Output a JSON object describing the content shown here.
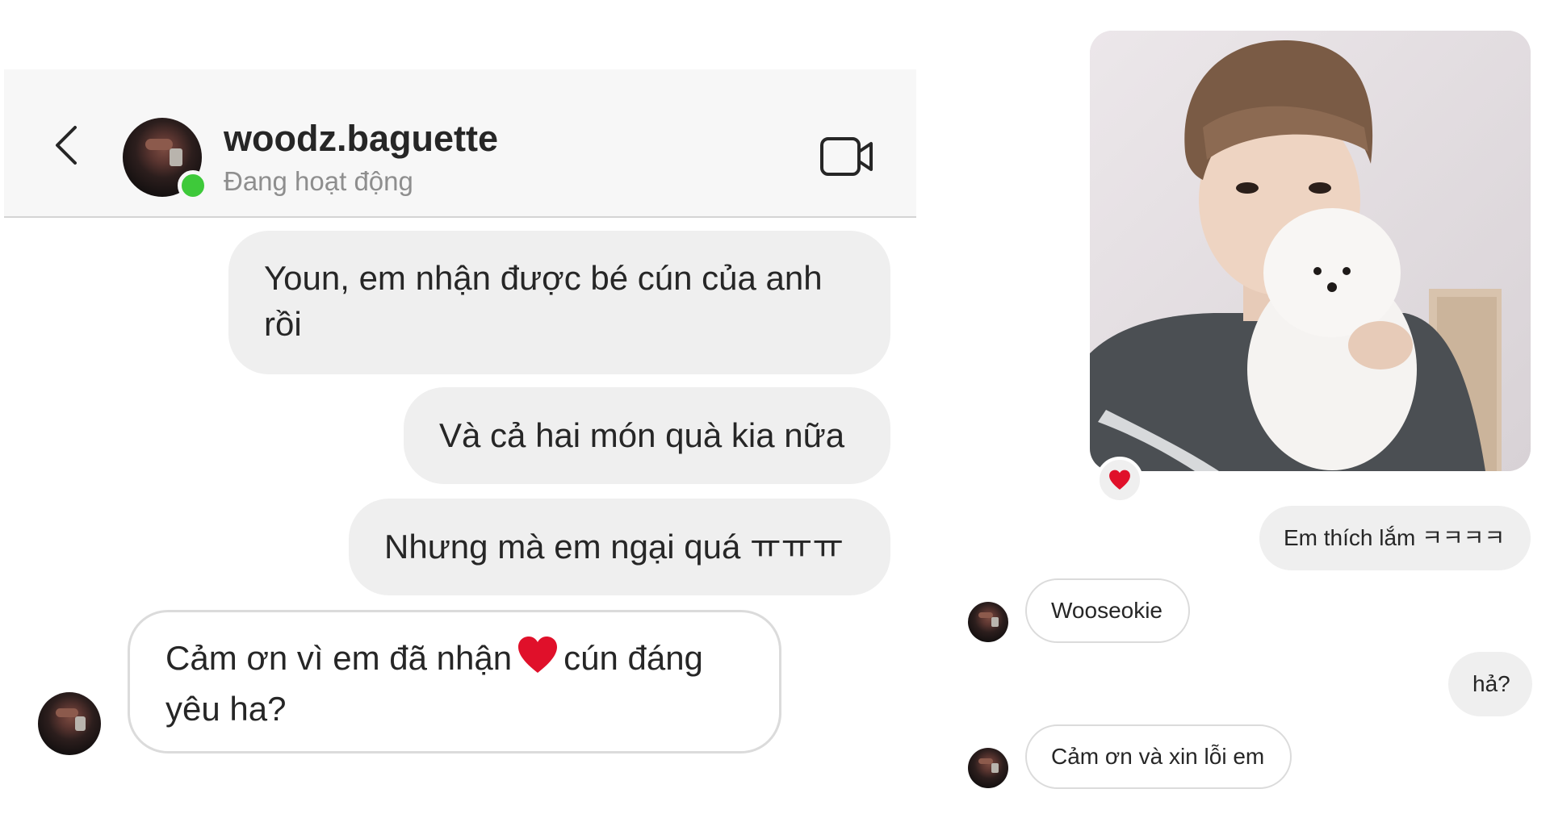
{
  "header": {
    "username": "woodz.baguette",
    "status": "Đang hoạt động"
  },
  "left_messages": {
    "m1": "Youn, em nhận được bé cún của anh rồi",
    "m2": "Và cả hai món quà kia nữa",
    "m3": "Nhưng mà em ngại quá ㅠㅠㅠ",
    "m4_before": "Cảm ơn vì em đã nhận",
    "m4_after": "cún đáng yêu ha?"
  },
  "right_messages": {
    "r1": "Em thích lắm ㅋㅋㅋㅋ",
    "r2": "Wooseokie",
    "r3": "hả?",
    "r4": "Cảm ơn và xin lỗi em"
  },
  "icons": {
    "back": "chevron-left-icon",
    "video": "video-camera-icon",
    "heart": "red-heart-icon"
  },
  "colors": {
    "online": "#3ec93a",
    "sent_bubble": "#efefef",
    "received_border": "#dbdbdb",
    "heart": "#e0102a"
  }
}
